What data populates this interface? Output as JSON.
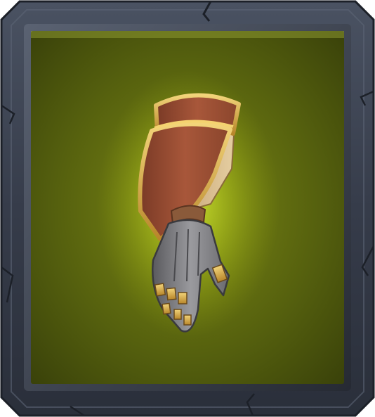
{
  "item_card": {
    "rarity_color": "#6b7a12",
    "frame_color": "#3a4150",
    "icon_name": "gauntlet-icon",
    "glow_color": "#d8f02a"
  }
}
